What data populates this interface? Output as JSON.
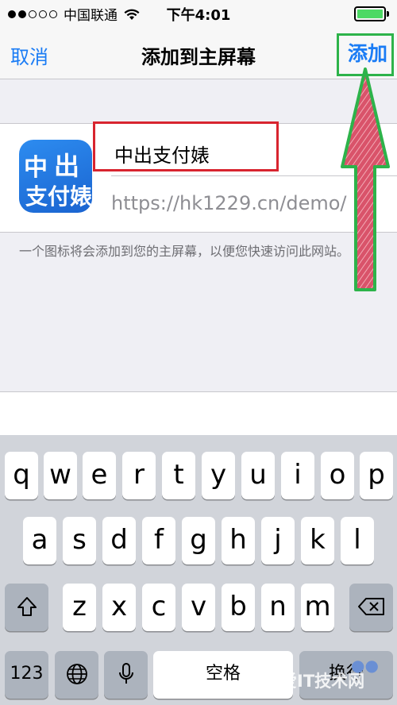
{
  "status": {
    "carrier": "中国联通",
    "time": "下午4:01",
    "colors": {
      "battery": "#4cd964"
    }
  },
  "nav": {
    "cancel": "取消",
    "title": "添加到主屏幕",
    "add": "添加",
    "colors": {
      "link": "#1a7cf5"
    }
  },
  "app": {
    "icon_chars": [
      "中",
      "出",
      "支付婊"
    ],
    "name_value": "中出支付婊",
    "url": "https://hk1229.cn/demo/"
  },
  "hint": "一个图标将会添加到您的主屏幕，以便您快速访问此网站。",
  "annotations": {
    "red_box_color": "#d8242f",
    "green_color": "#2db34a",
    "arrow_fill": "#d9536a"
  },
  "keyboard": {
    "row1": [
      "q",
      "w",
      "e",
      "r",
      "t",
      "y",
      "u",
      "i",
      "o",
      "p"
    ],
    "row2": [
      "a",
      "s",
      "d",
      "f",
      "g",
      "h",
      "j",
      "k",
      "l"
    ],
    "row3": [
      "z",
      "x",
      "c",
      "v",
      "b",
      "n",
      "m"
    ],
    "numbers": "123",
    "space": "空格",
    "return": "换行"
  },
  "watermark": "我爱IT技术网"
}
